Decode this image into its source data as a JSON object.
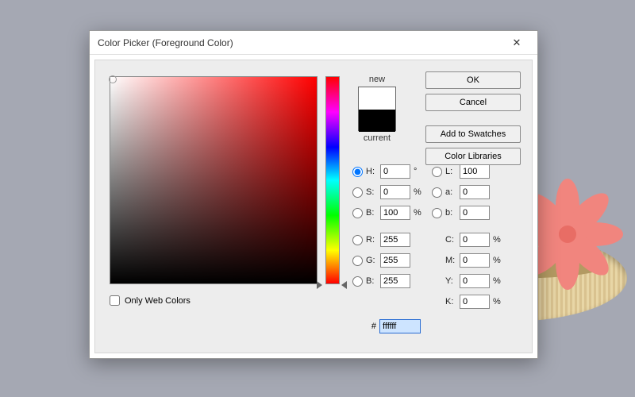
{
  "titlebar": {
    "title": "Color Picker (Foreground Color)",
    "close": "✕"
  },
  "buttons": {
    "ok": "OK",
    "cancel": "Cancel",
    "add_swatches": "Add to Swatches",
    "color_libraries": "Color Libraries"
  },
  "preview": {
    "new": "new",
    "current": "current",
    "new_color": "#ffffff",
    "current_color": "#000000"
  },
  "webcolors": {
    "label": "Only Web Colors",
    "checked": false
  },
  "hsb": {
    "h": {
      "label": "H:",
      "value": "0",
      "unit": "°"
    },
    "s": {
      "label": "S:",
      "value": "0",
      "unit": "%"
    },
    "b": {
      "label": "B:",
      "value": "100",
      "unit": "%"
    }
  },
  "lab": {
    "l": {
      "label": "L:",
      "value": "100"
    },
    "a": {
      "label": "a:",
      "value": "0"
    },
    "b": {
      "label": "b:",
      "value": "0"
    }
  },
  "rgb": {
    "r": {
      "label": "R:",
      "value": "255"
    },
    "g": {
      "label": "G:",
      "value": "255"
    },
    "b": {
      "label": "B:",
      "value": "255"
    }
  },
  "cmyk": {
    "c": {
      "label": "C:",
      "value": "0",
      "unit": "%"
    },
    "m": {
      "label": "M:",
      "value": "0",
      "unit": "%"
    },
    "y": {
      "label": "Y:",
      "value": "0",
      "unit": "%"
    },
    "k": {
      "label": "K:",
      "value": "0",
      "unit": "%"
    }
  },
  "hex": {
    "label": "#",
    "value": "ffffff"
  },
  "selected_mode": "H"
}
